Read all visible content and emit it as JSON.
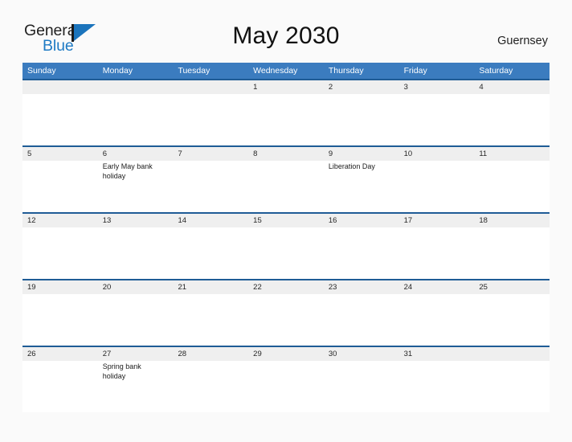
{
  "brand": {
    "name_part1": "General",
    "name_part2": "Blue",
    "flag_icon": "flag-icon"
  },
  "header": {
    "title": "May 2030",
    "locale": "Guernsey"
  },
  "colors": {
    "header_blue": "#3b7cbf",
    "row_rule_blue": "#1f5c96",
    "date_band_gray": "#efefef",
    "brand_blue": "#1e7ac4",
    "page_background": "#fafafa"
  },
  "calendar": {
    "weekdays": [
      "Sunday",
      "Monday",
      "Tuesday",
      "Wednesday",
      "Thursday",
      "Friday",
      "Saturday"
    ],
    "weeks": [
      {
        "dates": [
          "",
          "",
          "",
          "1",
          "2",
          "3",
          "4"
        ],
        "events": [
          "",
          "",
          "",
          "",
          "",
          "",
          ""
        ]
      },
      {
        "dates": [
          "5",
          "6",
          "7",
          "8",
          "9",
          "10",
          "11"
        ],
        "events": [
          "",
          "Early May bank holiday",
          "",
          "",
          "Liberation Day",
          "",
          ""
        ]
      },
      {
        "dates": [
          "12",
          "13",
          "14",
          "15",
          "16",
          "17",
          "18"
        ],
        "events": [
          "",
          "",
          "",
          "",
          "",
          "",
          ""
        ]
      },
      {
        "dates": [
          "19",
          "20",
          "21",
          "22",
          "23",
          "24",
          "25"
        ],
        "events": [
          "",
          "",
          "",
          "",
          "",
          "",
          ""
        ]
      },
      {
        "dates": [
          "26",
          "27",
          "28",
          "29",
          "30",
          "31",
          ""
        ],
        "events": [
          "",
          "Spring bank holiday",
          "",
          "",
          "",
          "",
          ""
        ]
      }
    ]
  }
}
